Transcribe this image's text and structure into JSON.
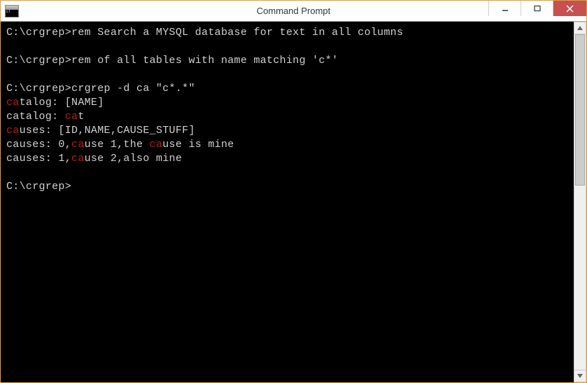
{
  "window": {
    "title": "Command Prompt"
  },
  "terminal": {
    "prompt": "C:\\crgrep>",
    "lines": [
      {
        "segments": [
          {
            "t": "C:\\crgrep>rem Search a MYSQL database for text in all columns"
          }
        ]
      },
      {
        "segments": []
      },
      {
        "segments": [
          {
            "t": "C:\\crgrep>rem of all tables with name matching 'c*'"
          }
        ]
      },
      {
        "segments": []
      },
      {
        "segments": [
          {
            "t": "C:\\crgrep>crgrep -d ca \"c*.*\""
          }
        ]
      },
      {
        "segments": [
          {
            "t": "ca",
            "hl": true
          },
          {
            "t": "talog: [NAME]"
          }
        ]
      },
      {
        "segments": [
          {
            "t": "catalog: "
          },
          {
            "t": "ca",
            "hl": true
          },
          {
            "t": "t"
          }
        ]
      },
      {
        "segments": [
          {
            "t": "ca",
            "hl": true
          },
          {
            "t": "uses: [ID,NAME,CAUSE_STUFF]"
          }
        ]
      },
      {
        "segments": [
          {
            "t": "causes: 0,"
          },
          {
            "t": "ca",
            "hl": true
          },
          {
            "t": "use 1,the "
          },
          {
            "t": "ca",
            "hl": true
          },
          {
            "t": "use is mine"
          }
        ]
      },
      {
        "segments": [
          {
            "t": "causes: 1,"
          },
          {
            "t": "ca",
            "hl": true
          },
          {
            "t": "use 2,also mine"
          }
        ]
      },
      {
        "segments": []
      },
      {
        "segments": [
          {
            "t": "C:\\crgrep>"
          }
        ]
      }
    ]
  }
}
